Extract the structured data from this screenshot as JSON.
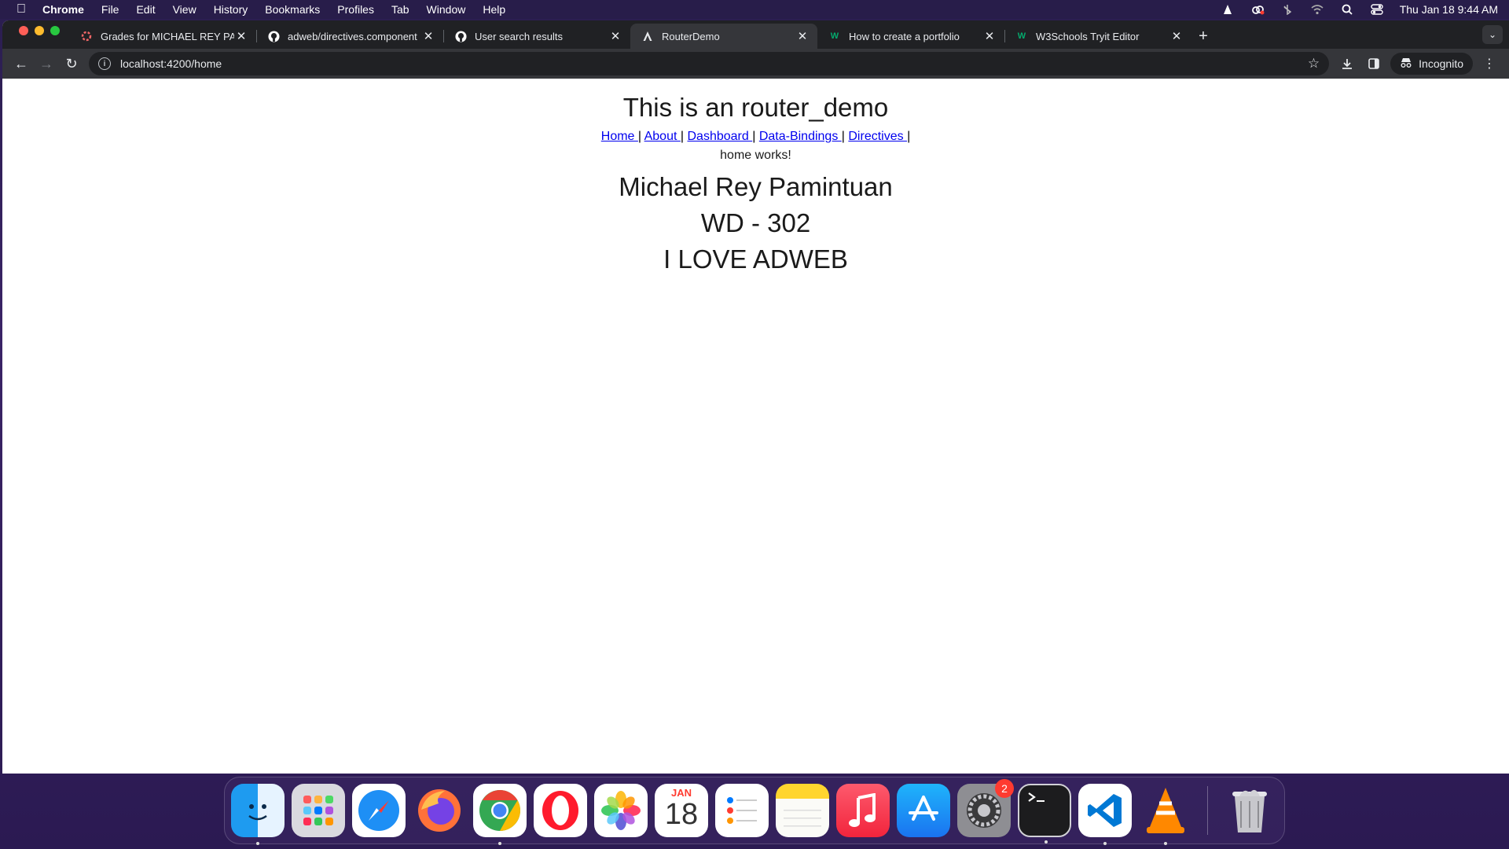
{
  "menubar": {
    "app_name": "Chrome",
    "items": [
      "File",
      "Edit",
      "View",
      "History",
      "Bookmarks",
      "Profiles",
      "Tab",
      "Window",
      "Help"
    ],
    "clock": "Thu Jan 18  9:44 AM"
  },
  "tabs": [
    {
      "title": "Grades for MICHAEL REY PAMINTUAN",
      "favicon": "canvas-icon",
      "active": false
    },
    {
      "title": "adweb/directives.component",
      "favicon": "github-icon",
      "active": false
    },
    {
      "title": "User search results",
      "favicon": "github-icon",
      "active": false
    },
    {
      "title": "RouterDemo",
      "favicon": "angular-icon",
      "active": true
    },
    {
      "title": "How to create a portfolio",
      "favicon": "w3schools-icon",
      "active": false
    },
    {
      "title": "W3Schools Tryit Editor",
      "favicon": "w3schools-icon",
      "active": false
    }
  ],
  "toolbar": {
    "url": "localhost:4200/home",
    "profile_label": "Incognito"
  },
  "page": {
    "title": "This is an router_demo",
    "nav": [
      {
        "label": "Home "
      },
      {
        "label": "About "
      },
      {
        "label": "Dashboard "
      },
      {
        "label": "Data-Bindings "
      },
      {
        "label": "Directives "
      }
    ],
    "separator": "|",
    "status": "home works!",
    "name": "Michael Rey Pamintuan",
    "section": "WD - 302",
    "message": "I LOVE ADWEB"
  },
  "dock": {
    "apps": [
      "finder",
      "launchpad",
      "safari",
      "firefox",
      "chrome",
      "opera",
      "photos",
      "calendar",
      "reminders",
      "notes",
      "music",
      "app-store",
      "system-settings",
      "terminal",
      "vscode",
      "vlc",
      "trash"
    ],
    "calendar_month": "JAN",
    "calendar_day": "18",
    "settings_badge": "2"
  },
  "colors": {
    "link": "#0000ee",
    "tabstrip": "#202124",
    "toolbar": "#35363a"
  }
}
